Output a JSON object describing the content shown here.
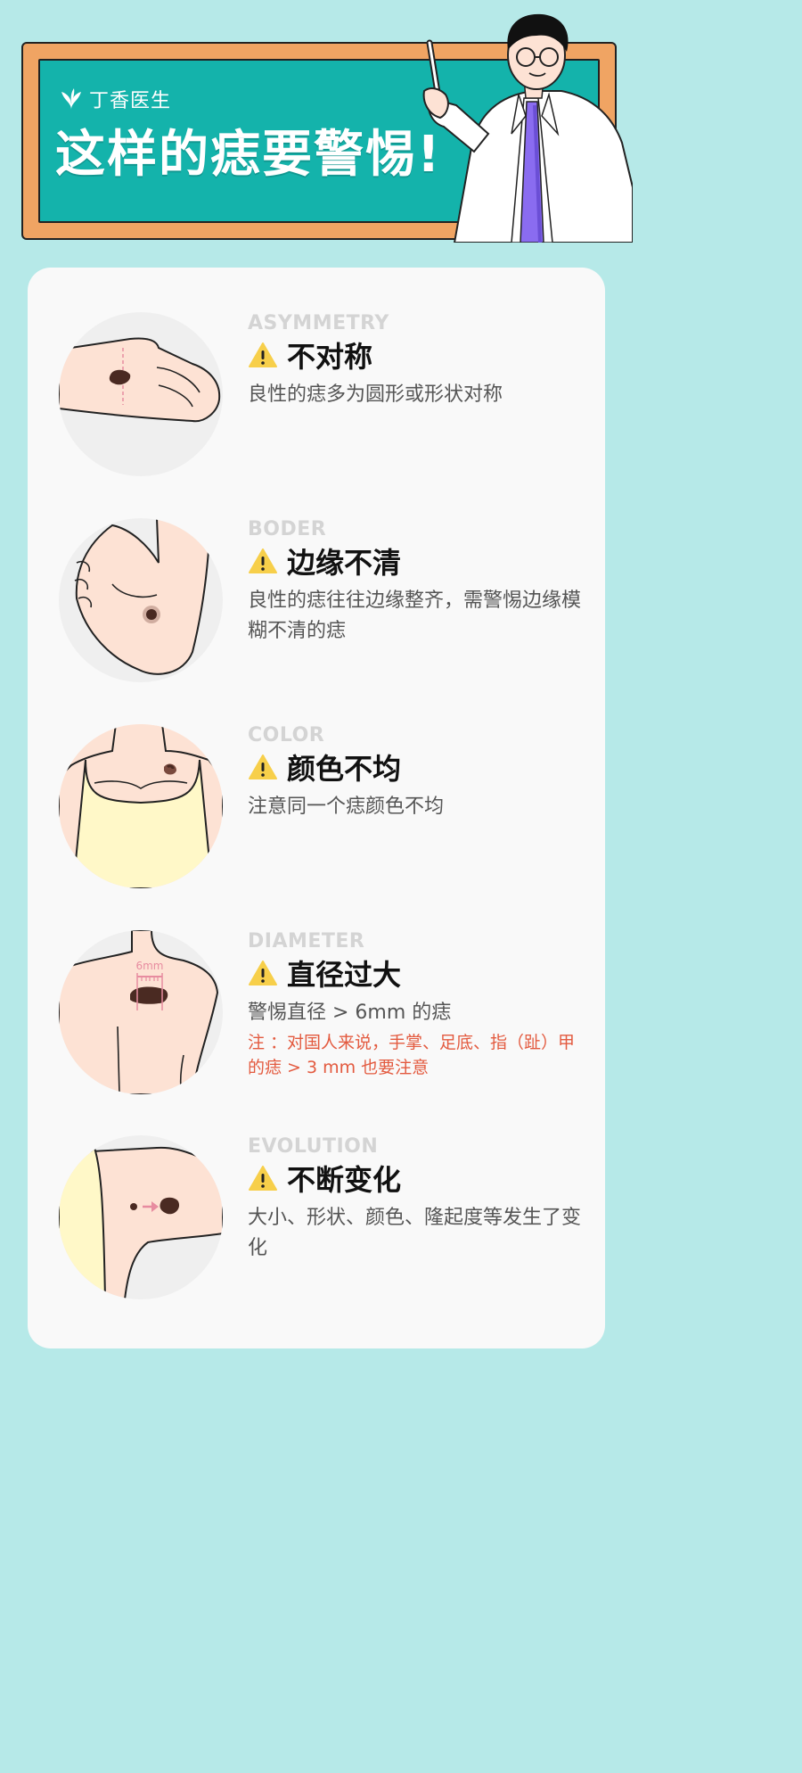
{
  "header": {
    "brand": "丁香医生",
    "headline": "这样的痣要警惕!"
  },
  "items": [
    {
      "en": "ASYMMETRY",
      "title": "不对称",
      "desc": "良性的痣多为圆形或形状对称"
    },
    {
      "en": "BODER",
      "title": "边缘不清",
      "desc": "良性的痣往往边缘整齐，需警惕边缘模糊不清的痣"
    },
    {
      "en": "COLOR",
      "title": "颜色不均",
      "desc": "注意同一个痣颜色不均"
    },
    {
      "en": "DIAMETER",
      "title": "直径过大",
      "desc": "警惕直径 > 6mm 的痣",
      "note": "注 ：对国人来说，手掌、足底、指（趾）甲的痣 > 3 mm 也要注意",
      "ruler_label": "6mm"
    },
    {
      "en": "EVOLUTION",
      "title": "不断变化",
      "desc": "大小、形状、颜色、隆起度等发生了变化"
    }
  ],
  "colors": {
    "background": "#b6e9e8",
    "board": "#f0a463",
    "board_inner": "#14b3ab",
    "card": "#f9f9f9",
    "warning": "#f7cf4a",
    "note": "#e35a3f",
    "skin": "#fde2d4"
  }
}
